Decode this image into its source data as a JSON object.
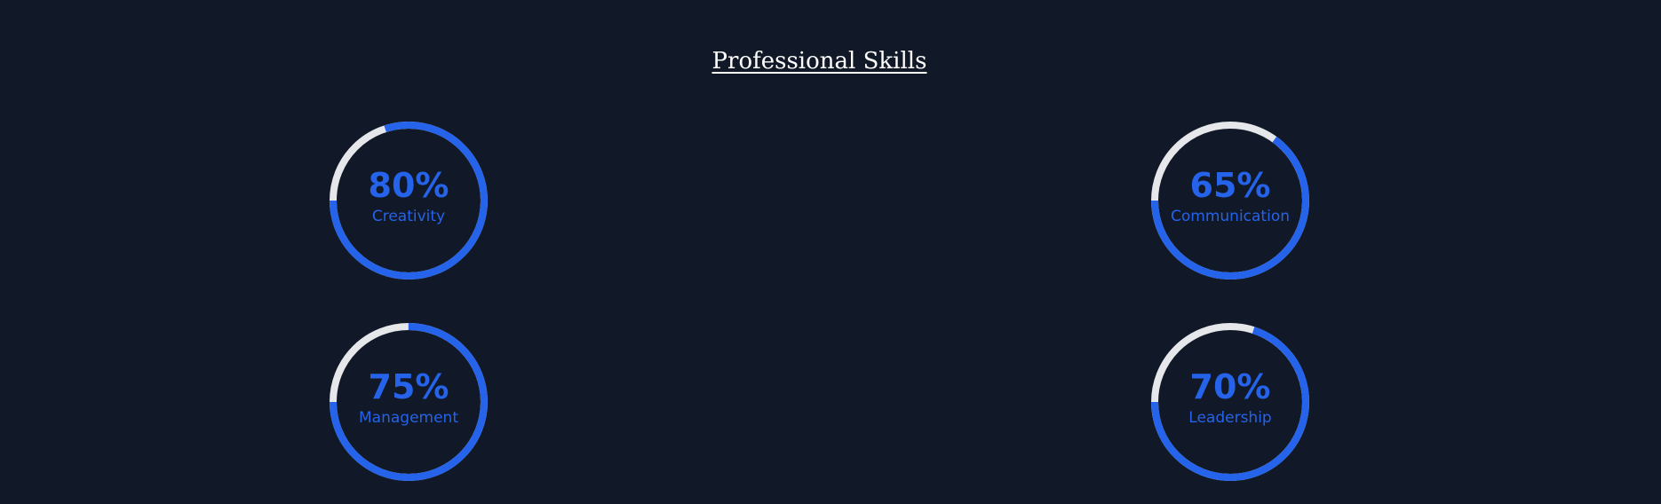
{
  "section": {
    "title": "Professional Skills"
  },
  "colors": {
    "background": "#111827",
    "accent": "#2563eb",
    "track": "#e5e7eb",
    "title": "#ffffff"
  },
  "skills": [
    {
      "percent_label": "80%",
      "name": "Creativity",
      "value": 80
    },
    {
      "percent_label": "65%",
      "name": "Communication",
      "value": 65
    },
    {
      "percent_label": "75%",
      "name": "Management",
      "value": 75
    },
    {
      "percent_label": "70%",
      "name": "Leadership",
      "value": 70
    }
  ]
}
